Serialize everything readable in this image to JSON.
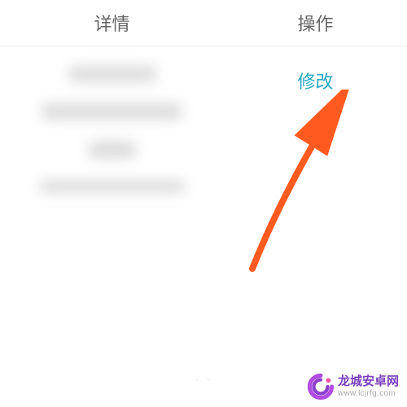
{
  "header": {
    "detail_label": "详情",
    "action_label": "操作"
  },
  "actions": {
    "edit_label": "修改"
  },
  "colors": {
    "arrow": "#ff5a1f",
    "link": "#2aa6c4",
    "watermark_brand": "#7b3fbf"
  },
  "watermark": {
    "title": "龙城安卓网",
    "url": "www.lcjrfg.com"
  },
  "icons": {
    "arrow": "arrow-pointer-icon",
    "logo": "watermark-logo-icon"
  }
}
